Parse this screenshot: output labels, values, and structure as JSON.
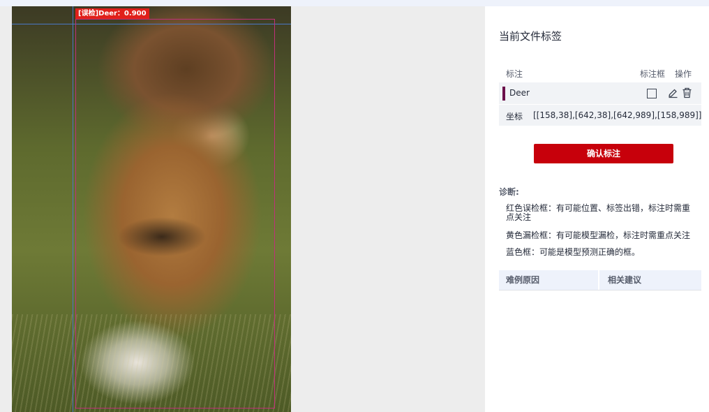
{
  "image_annotation": {
    "label_tag": "[误检]Deer：0.900",
    "frame_color": "#c0307a",
    "tag_color": "#e0201a"
  },
  "panel": {
    "title": "当前文件标签",
    "table_headers": {
      "label": "标注",
      "box": "标注框",
      "action": "操作"
    },
    "label_row": {
      "name": "Deer",
      "color": "#6b0f4a"
    },
    "coord_row": {
      "key": "坐标",
      "value": "[[158,38],[642,38],[642,989],[158,989]]"
    },
    "confirm_button": "确认标注",
    "diagnosis": {
      "title": "诊断:",
      "items": [
        "红色误检框：有可能位置、标签出错，标注时需重点关注",
        "黄色漏检框：有可能模型漏检，标注时需重点关注",
        "蓝色框：可能是模型预测正确的框。"
      ]
    },
    "reason_table": {
      "col1": "难例原因",
      "col2": "相关建议"
    }
  },
  "icons": [
    "box-square-icon",
    "edit-pencil-icon",
    "trash-icon"
  ]
}
